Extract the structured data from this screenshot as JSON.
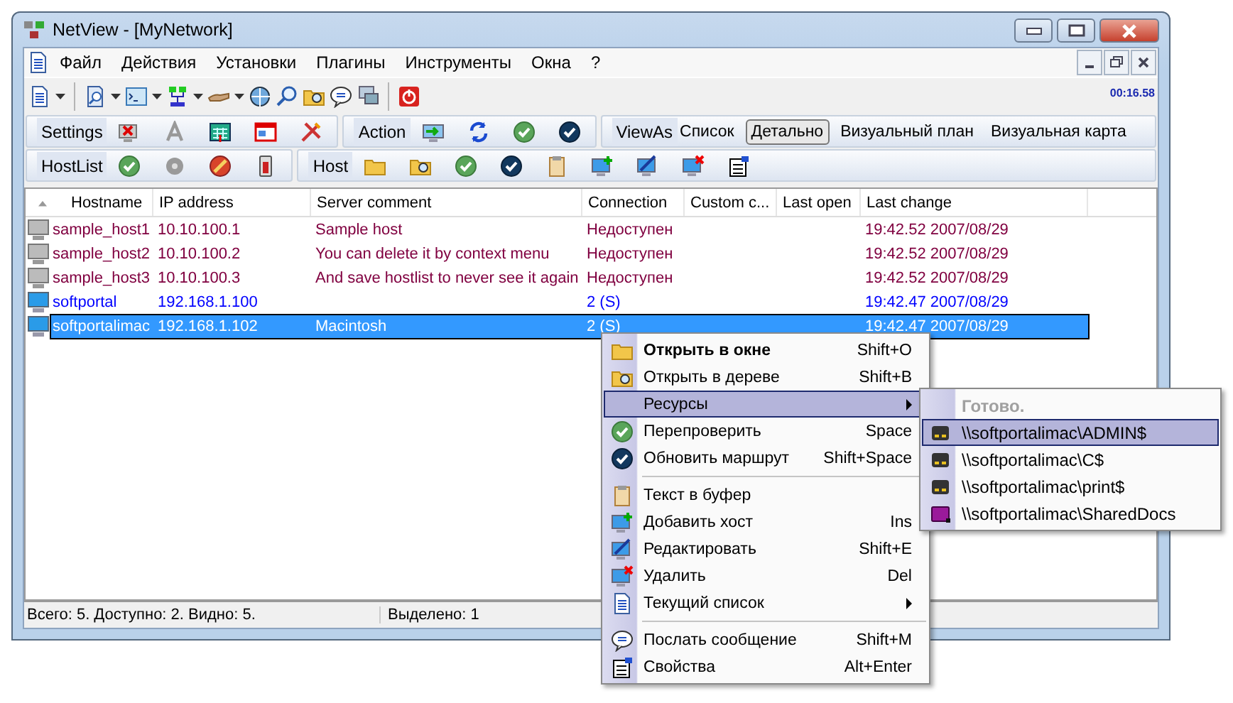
{
  "window": {
    "title": "NetView - [MyNetwork]"
  },
  "menu_bar": {
    "items": [
      "Файл",
      "Действия",
      "Установки",
      "Плагины",
      "Инструменты",
      "Окна",
      "?"
    ]
  },
  "toolbar": {
    "timer": "00:16.58"
  },
  "bands": [
    {
      "kind": "icons",
      "label": "Settings"
    },
    {
      "kind": "icons",
      "label": "Action"
    },
    {
      "kind": "views",
      "label": "ViewAs",
      "options": [
        {
          "label": "Список",
          "selected": false
        },
        {
          "label": "Детально",
          "selected": true
        },
        {
          "label": "Визуальный план",
          "selected": false
        },
        {
          "label": "Визуальная карта",
          "selected": false
        }
      ]
    },
    {
      "kind": "icons",
      "label": "HostList"
    },
    {
      "kind": "icons",
      "label": "Host"
    }
  ],
  "table": {
    "columns": [
      "Hostname",
      "IP address",
      "Server comment",
      "Connection",
      "Custom c...",
      "Last open",
      "Last change"
    ],
    "rows": [
      {
        "hostname": "sample_host1",
        "ip": "10.10.100.1",
        "comment": "Sample host",
        "connection": "Недоступен",
        "last_change": "19:42.52 2007/08/29",
        "available": false,
        "selected": false
      },
      {
        "hostname": "sample_host2",
        "ip": "10.10.100.2",
        "comment": "You can delete it by context menu",
        "connection": "Недоступен",
        "last_change": "19:42.52 2007/08/29",
        "available": false,
        "selected": false
      },
      {
        "hostname": "sample_host3",
        "ip": "10.10.100.3",
        "comment": "And save hostlist to never see it again",
        "connection": "Недоступен",
        "last_change": "19:42.52 2007/08/29",
        "available": false,
        "selected": false
      },
      {
        "hostname": "softportal",
        "ip": "192.168.1.100",
        "connection": "2 (S)",
        "last_change": "19:42.47 2007/08/29",
        "available": true,
        "selected": false
      },
      {
        "hostname": "softportalimac",
        "ip": "192.168.1.102",
        "comment": "Macintosh",
        "connection": "2 (S)",
        "last_change": "19:42.47 2007/08/29",
        "available": true,
        "selected": true
      }
    ]
  },
  "status_bar": [
    "Всего: 5. Доступно: 2. Видно: 5.",
    "Выделено: 1"
  ],
  "context_menu": {
    "items": [
      {
        "kind": "item",
        "label": "Открыть в окне",
        "shortcut": "Shift+O",
        "default": true,
        "submenu": false,
        "selected": false
      },
      {
        "kind": "item",
        "label": "Открыть в дереве",
        "shortcut": "Shift+B",
        "default": false,
        "submenu": false,
        "selected": false
      },
      {
        "kind": "item",
        "label": "Ресурсы",
        "default": false,
        "submenu": true,
        "selected": true
      },
      {
        "kind": "item",
        "label": "Перепроверить",
        "shortcut": "Space",
        "default": false,
        "submenu": false,
        "selected": false
      },
      {
        "kind": "item",
        "label": "Обновить маршрут",
        "shortcut": "Shift+Space",
        "default": false,
        "submenu": false,
        "selected": false
      },
      {
        "kind": "separator"
      },
      {
        "kind": "item",
        "label": "Текст в буфер",
        "default": false,
        "submenu": false,
        "selected": false
      },
      {
        "kind": "item",
        "label": "Добавить хост",
        "shortcut": "Ins",
        "default": false,
        "submenu": false,
        "selected": false
      },
      {
        "kind": "item",
        "label": "Редактировать",
        "shortcut": "Shift+E",
        "default": false,
        "submenu": false,
        "selected": false
      },
      {
        "kind": "item",
        "label": "Удалить",
        "shortcut": "Del",
        "default": false,
        "submenu": false,
        "selected": false
      },
      {
        "kind": "item",
        "label": "Текущий список",
        "default": false,
        "submenu": true,
        "selected": false
      },
      {
        "kind": "separator"
      },
      {
        "kind": "item",
        "label": "Послать сообщение",
        "shortcut": "Shift+M",
        "default": false,
        "submenu": false,
        "selected": false
      },
      {
        "kind": "item",
        "label": "Свойства",
        "shortcut": "Alt+Enter",
        "default": false,
        "submenu": false,
        "selected": false
      }
    ]
  },
  "submenu": {
    "items": [
      {
        "kind": "header",
        "label": "Готово.",
        "disabled": true,
        "selected": false
      },
      {
        "kind": "item",
        "label": "\\\\softportalimac\\ADMIN$",
        "disabled": false,
        "selected": true
      },
      {
        "kind": "item",
        "label": "\\\\softportalimac\\C$",
        "disabled": false,
        "selected": false
      },
      {
        "kind": "item",
        "label": "\\\\softportalimac\\print$",
        "disabled": false,
        "selected": false
      },
      {
        "kind": "item",
        "label": "\\\\softportalimac\\SharedDocs",
        "disabled": false,
        "selected": false
      }
    ]
  }
}
